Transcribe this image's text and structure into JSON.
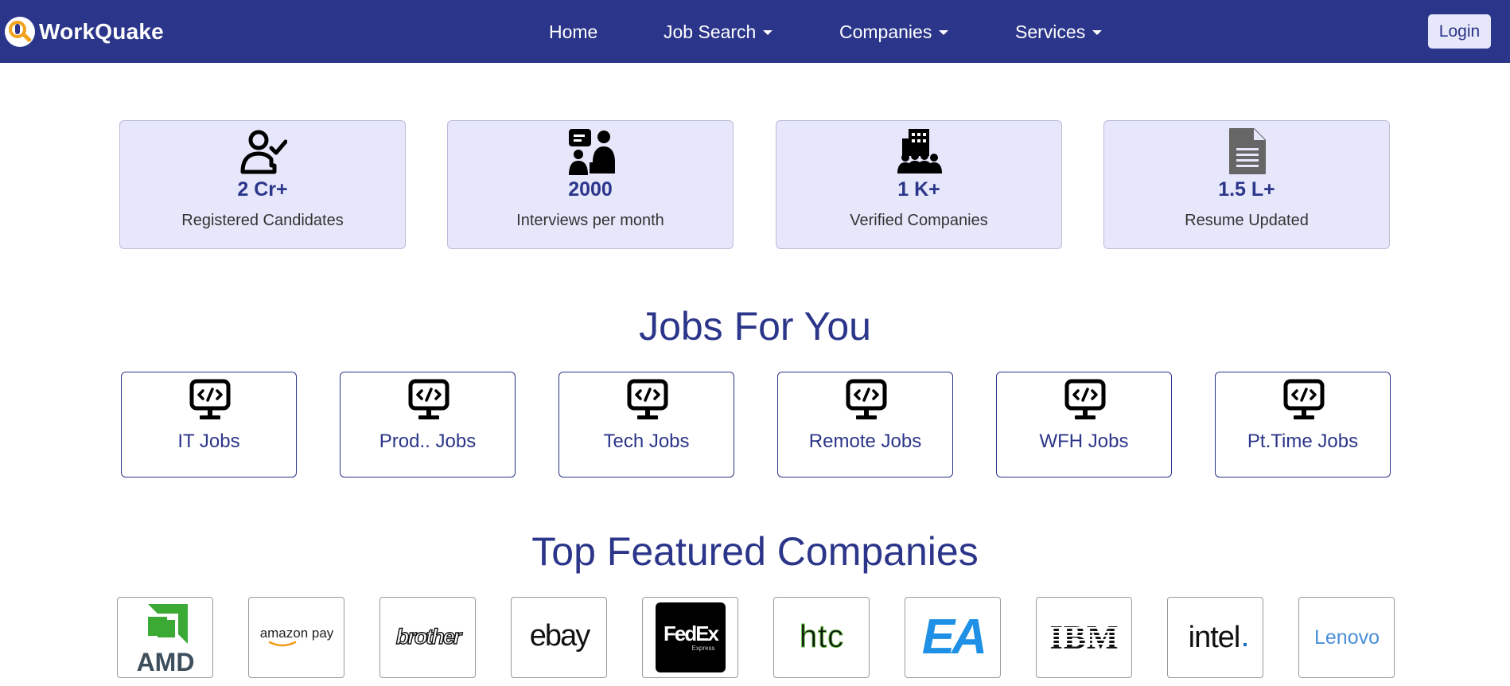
{
  "brand": {
    "name": "WorkQuake",
    "logo_icon": "magnifier-person-logo"
  },
  "nav": {
    "home": "Home",
    "job_search": "Job Search",
    "companies": "Companies",
    "services": "Services",
    "login": "Login"
  },
  "stats": [
    {
      "value": "2 Cr+",
      "label": "Registered Candidates",
      "icon": "user-check-icon"
    },
    {
      "value": "2000",
      "label": "Interviews per month",
      "icon": "interview-icon"
    },
    {
      "value": "1 K+",
      "label": "Verified Companies",
      "icon": "company-building-icon"
    },
    {
      "value": "1.5 L+",
      "label": "Resume Updated",
      "icon": "document-icon"
    }
  ],
  "jobs_section": {
    "title": "Jobs For You",
    "items": [
      {
        "label": "IT Jobs",
        "icon": "code-monitor-icon"
      },
      {
        "label": "Prod.. Jobs",
        "icon": "code-monitor-icon"
      },
      {
        "label": "Tech Jobs",
        "icon": "code-monitor-icon"
      },
      {
        "label": "Remote Jobs",
        "icon": "code-monitor-icon"
      },
      {
        "label": "WFH Jobs",
        "icon": "code-monitor-icon"
      },
      {
        "label": "Pt.Time Jobs",
        "icon": "code-monitor-icon"
      }
    ]
  },
  "companies_section": {
    "title": "Top Featured Companies",
    "logos": [
      {
        "text": "AMD",
        "color": "#3aaa35"
      },
      {
        "text": "amazon pay",
        "color": "#222222"
      },
      {
        "text": "brother",
        "color": "#111111"
      },
      {
        "text": "ebay",
        "color": "#111111"
      },
      {
        "text": "FedEx",
        "sub": "Express",
        "color": "#ffffff"
      },
      {
        "text": "htc",
        "color": "#111111"
      },
      {
        "text": "EA",
        "color": "#1e90e6"
      },
      {
        "text": "IBM",
        "color": "#111111"
      },
      {
        "text": "intel",
        "color": "#111111"
      },
      {
        "text": "Lenovo",
        "color": "#4a8fd9"
      }
    ]
  },
  "colors": {
    "primary": "#2b3589",
    "card_bg": "#e6e7fb"
  }
}
